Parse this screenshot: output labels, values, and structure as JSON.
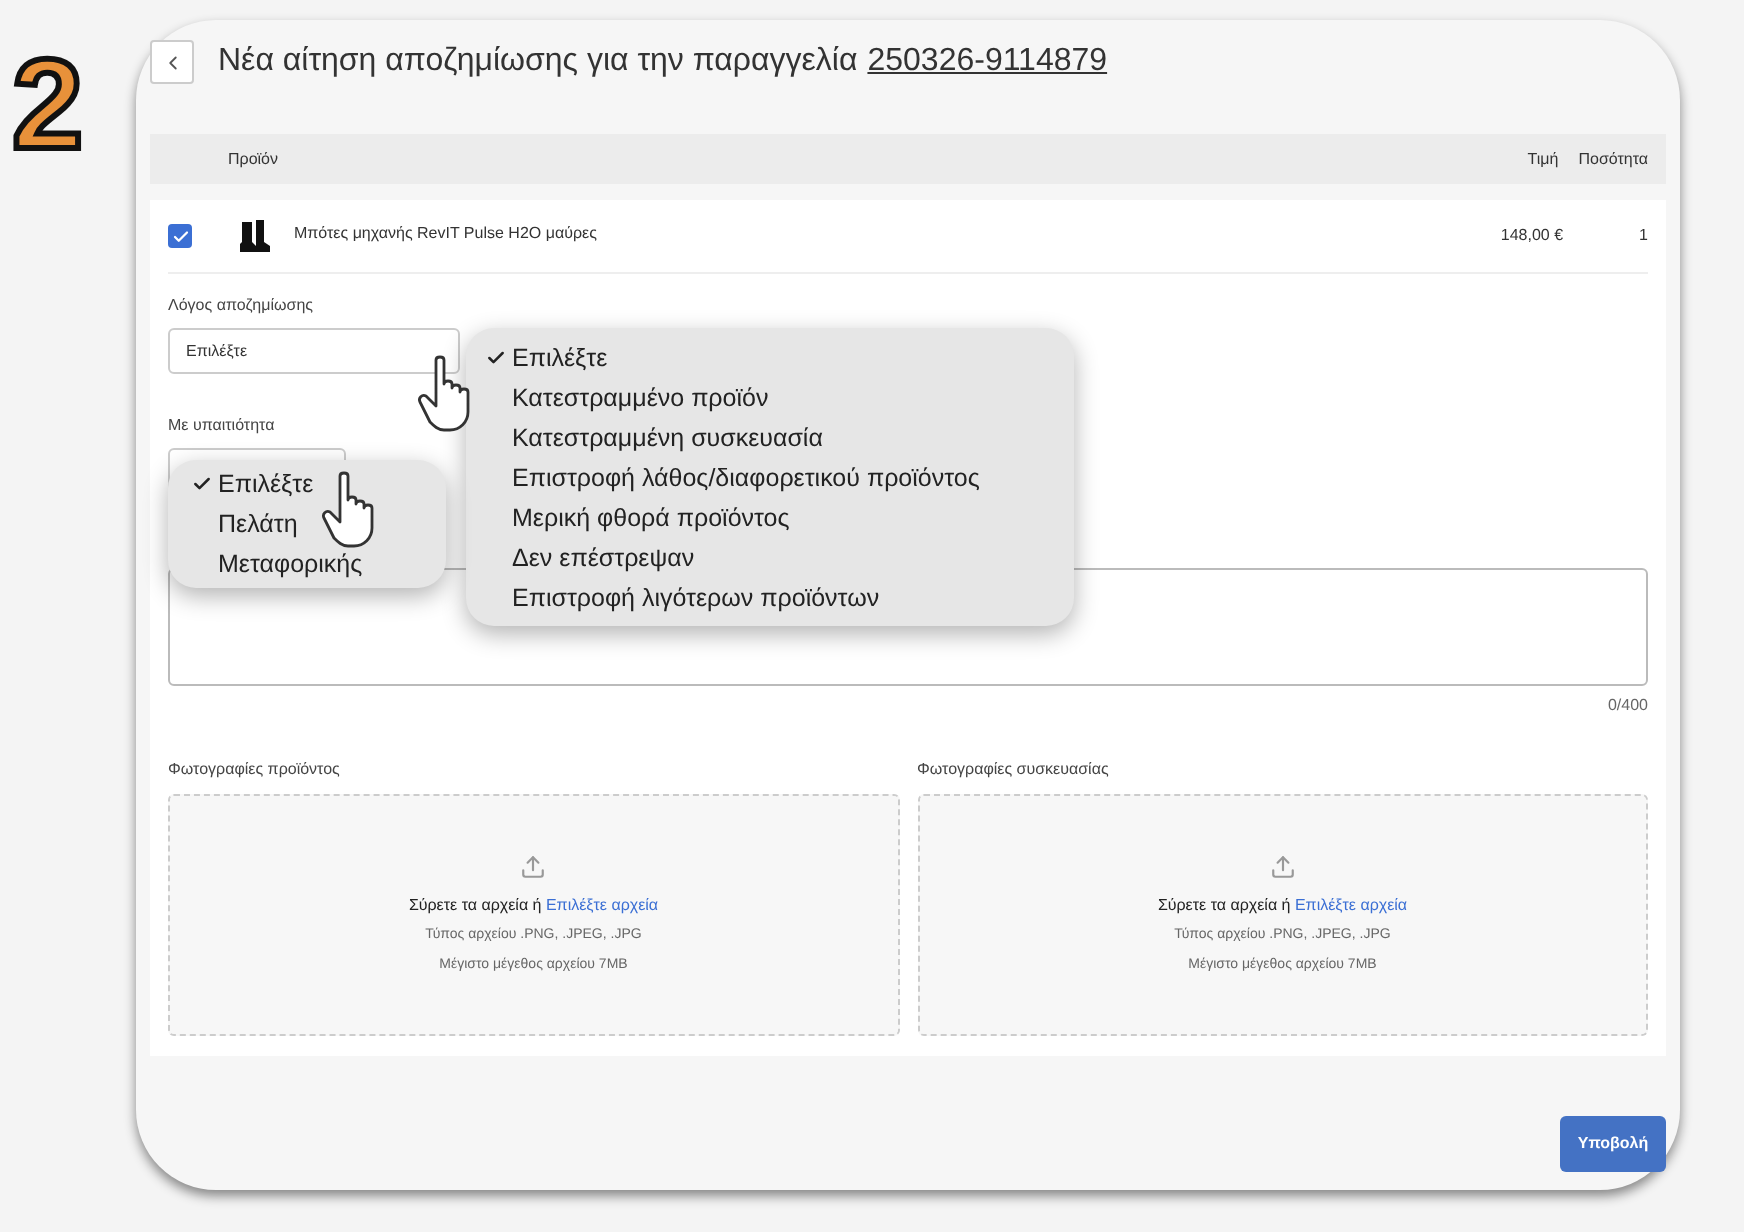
{
  "step_number": "2",
  "title": {
    "text": "Νέα αίτηση αποζημίωσης για την παραγγελία",
    "order_link": "250326-9114879"
  },
  "table": {
    "columns": [
      "Προϊόν",
      "Τιμή",
      "Ποσότητα"
    ],
    "rows": [
      {
        "checked": true,
        "product": "Μπότες μηχανής RevIT Pulse H2O μαύρες",
        "price": "148,00 €",
        "quantity": "1"
      }
    ]
  },
  "reason": {
    "label": "Λόγος αποζημίωσης",
    "value": "Επιλέξτε",
    "menu": [
      {
        "label": "Επιλέξτε",
        "selected": true
      },
      {
        "label": "Κατεστραμμένο προϊόν",
        "selected": false
      },
      {
        "label": "Κατεστραμμένη συσκευασία",
        "selected": false
      },
      {
        "label": "Επιστροφή λάθος/διαφορετικού προϊόντος",
        "selected": false
      },
      {
        "label": "Μερική φθορά προϊόντος",
        "selected": false
      },
      {
        "label": "Δεν επέστρεψαν",
        "selected": false
      },
      {
        "label": "Επιστροφή λιγότερων προϊόντων",
        "selected": false
      }
    ]
  },
  "fault": {
    "label": "Με υπαιτιότητα",
    "menu": [
      {
        "label": "Επιλέξτε",
        "selected": true
      },
      {
        "label": "Πελάτη",
        "selected": false
      },
      {
        "label": "Μεταφορικής",
        "selected": false
      }
    ]
  },
  "comment": {
    "counter": "0/400"
  },
  "uploads": [
    {
      "label": "Φωτογραφίες προϊόντος",
      "prompt": "Σύρετε τα αρχεία ή",
      "link": "Επιλέξτε αρχεία",
      "types": "Τύπος αρχείου .PNG, .JPEG, .JPG",
      "max_size": "Μέγιστο μέγεθος αρχείου 7MB"
    },
    {
      "label": "Φωτογραφίες συσκευασίας",
      "prompt": "Σύρετε τα αρχεία ή",
      "link": "Επιλέξτε αρχεία",
      "types": "Τύπος αρχείου .PNG, .JPEG, .JPG",
      "max_size": "Μέγιστο μέγεθος αρχείου 7MB"
    }
  ],
  "submit_button": "Υποβολή"
}
